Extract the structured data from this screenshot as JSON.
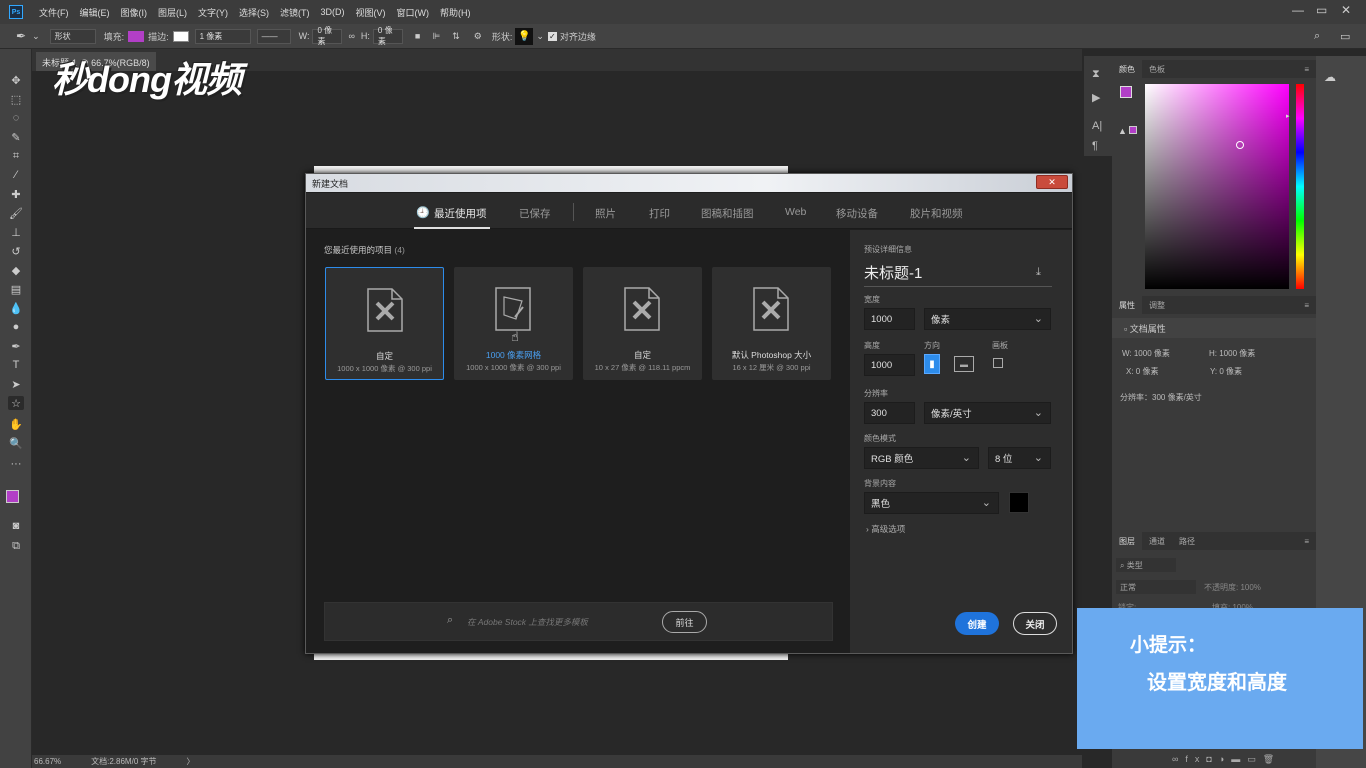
{
  "app": {
    "badge": "Ps"
  },
  "menu": [
    "文件(F)",
    "编辑(E)",
    "图像(I)",
    "图层(L)",
    "文字(Y)",
    "选择(S)",
    "滤镜(T)",
    "3D(D)",
    "视图(V)",
    "窗口(W)",
    "帮助(H)"
  ],
  "options": {
    "mode": "形状",
    "fill_label": "填充:",
    "stroke_label": "描边:",
    "stroke_width": "1 像素",
    "w_label": "W:",
    "w_value": "0 像素",
    "h_label": "H:",
    "h_value": "0 像素",
    "shape_label": "形状:",
    "align_edges": "对齐边缘",
    "fill_color": "#b23fc7"
  },
  "doc_tab": {
    "title": "未标题-1 @ 66.7%(RGB/8)"
  },
  "status": {
    "zoom": "66.67%",
    "doc": "文档:2.86M/0 字节"
  },
  "watermark": "秒dong视频",
  "colors": {
    "fg": "#b23fc7",
    "bg": "#111111",
    "accent": "#1f73db",
    "tip_bg": "#6aaaf0"
  },
  "panels": {
    "color_tabs": [
      "颜色",
      "色板"
    ],
    "props_tabs": [
      "属性",
      "调整"
    ],
    "props_title": "文档属性",
    "props_w": "W:  1000 像素",
    "props_h": "H:  1000 像素",
    "props_x": "X:  0 像素",
    "props_y": "Y:  0 像素",
    "props_res": "分辨率：300 像素/英寸",
    "layers_tabs": [
      "图层",
      "通道",
      "路径"
    ],
    "layers_kind": "类型",
    "layers_mode": "正常",
    "layers_opacity": "不透明度: 100%",
    "layers_lock": "锁定:",
    "layers_fill": "填充: 100%"
  },
  "dialog": {
    "title": "新建文档",
    "close_symbol": "✕",
    "tabs": [
      "最近使用项",
      "已保存",
      "照片",
      "打印",
      "图稿和插图",
      "Web",
      "移动设备",
      "胶片和视频"
    ],
    "recent_heading": "您最近使用的项目",
    "recent_count": "(4)",
    "cards": [
      {
        "name": "自定",
        "sub": "1000 x 1000 像素 @ 300 ppi"
      },
      {
        "name": "1000 像素网格",
        "sub": "1000 x 1000 像素 @ 300 ppi"
      },
      {
        "name": "自定",
        "sub": "10 x 27 像素 @ 118.11 ppcm"
      },
      {
        "name": "默认 Photoshop 大小",
        "sub": "16 x 12 厘米 @ 300 ppi"
      }
    ],
    "search_placeholder": "在 Adobe Stock 上查找更多模板",
    "go_label": "前往",
    "preset": {
      "heading": "预设详细信息",
      "name": "未标题-1",
      "width_label": "宽度",
      "width_value": "1000",
      "width_unit": "像素",
      "height_label": "高度",
      "height_value": "1000",
      "orient_label": "方向",
      "artboard_label": "画板",
      "res_label": "分辨率",
      "res_value": "300",
      "res_unit": "像素/英寸",
      "color_mode_label": "颜色模式",
      "color_mode": "RGB 颜色",
      "bit_depth": "8 位",
      "bg_label": "背景内容",
      "bg_value": "黑色",
      "advanced": "高级选项"
    },
    "create_label": "创建",
    "close_label": "关闭"
  },
  "tip": {
    "title": "小提示：",
    "body": "设置宽度和高度"
  }
}
